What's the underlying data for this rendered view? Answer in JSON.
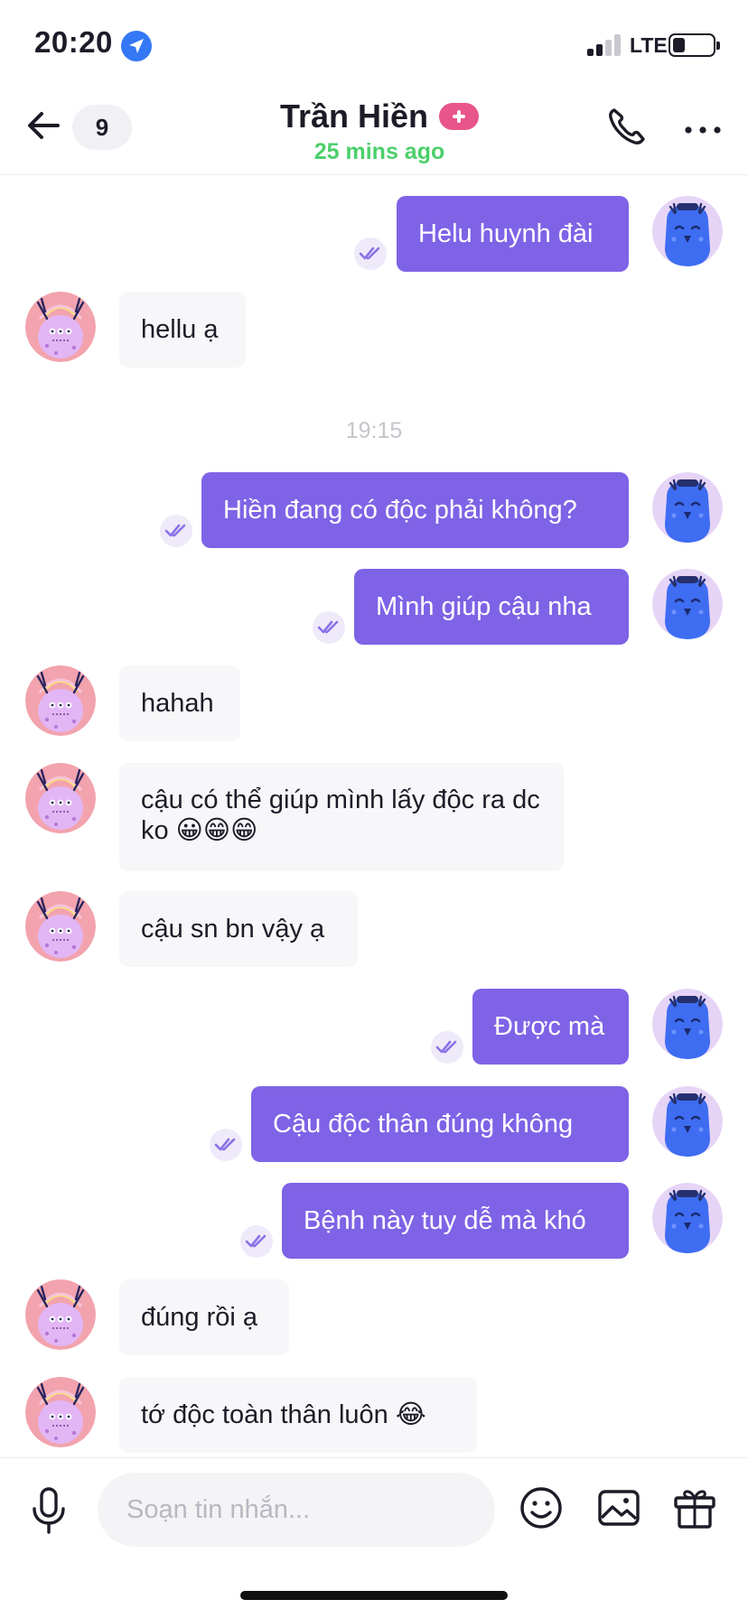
{
  "status_bar": {
    "time": "20:20",
    "network": "LTE",
    "signal_bars_filled": 2,
    "signal_bars_total": 4,
    "battery_level": 0.3
  },
  "header": {
    "unread_count": "9",
    "contact_name": "Trần Hiền",
    "last_seen": "25 mins ago",
    "icons": [
      "back-arrow-icon",
      "phone-icon",
      "more-icon",
      "plus-badge-icon"
    ]
  },
  "messages": [
    {
      "dir": "out",
      "text": "Helu huynh đài"
    },
    {
      "dir": "in",
      "text": "hellu ạ"
    },
    {
      "dir": "time",
      "text": "19:15"
    },
    {
      "dir": "out",
      "text": "Hiền đang có độc phải không?"
    },
    {
      "dir": "out",
      "text": "Mình giúp cậu nha"
    },
    {
      "dir": "in",
      "text": "hahah"
    },
    {
      "dir": "in",
      "text": "cậu có thể giúp mình lấy độc ra dc ko 😀😁😁"
    },
    {
      "dir": "in",
      "text": "cậu sn bn vậy ạ"
    },
    {
      "dir": "out",
      "text": "Được mà"
    },
    {
      "dir": "out",
      "text": "Cậu độc thân đúng không"
    },
    {
      "dir": "out",
      "text": "Bệnh này tuy dễ mà khó"
    },
    {
      "dir": "in",
      "text": "đúng rồi ạ"
    },
    {
      "dir": "in",
      "text": "tớ độc toàn thân luôn 😂"
    }
  ],
  "composer": {
    "placeholder": "Soạn tin nhắn...",
    "icons": [
      "microphone-icon",
      "emoji-icon",
      "photo-icon",
      "gift-icon"
    ]
  },
  "colors": {
    "outgoing_bubble": "#7e63e6",
    "incoming_bubble": "#f7f7f9",
    "online_status": "#4ccf6b",
    "plus_badge": "#e8558a",
    "location_badge": "#3478f6",
    "read_tick": "#8a72e8"
  }
}
